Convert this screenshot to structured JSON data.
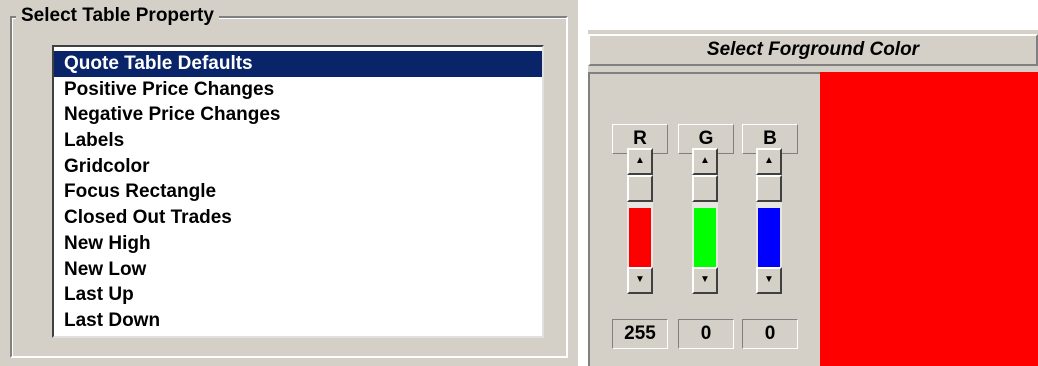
{
  "table_property": {
    "legend": "Select Table Property",
    "items": [
      "Quote Table Defaults",
      "Positive Price Changes",
      "Negative Price Changes",
      "Labels",
      "Gridcolor",
      "Focus Rectangle",
      "Closed Out Trades",
      "New High",
      "New Low",
      "Last Up",
      "Last Down"
    ],
    "selected_index": 0
  },
  "color_picker": {
    "title": "Select Forground Color",
    "channels": [
      {
        "label": "R",
        "value": "255",
        "fill_color": "#ff0000"
      },
      {
        "label": "G",
        "value": "0",
        "fill_color": "#00ff00"
      },
      {
        "label": "B",
        "value": "0",
        "fill_color": "#0000ff"
      }
    ],
    "preview_color": "#ff0000",
    "arrow_up": "▲",
    "arrow_down": "▼"
  }
}
